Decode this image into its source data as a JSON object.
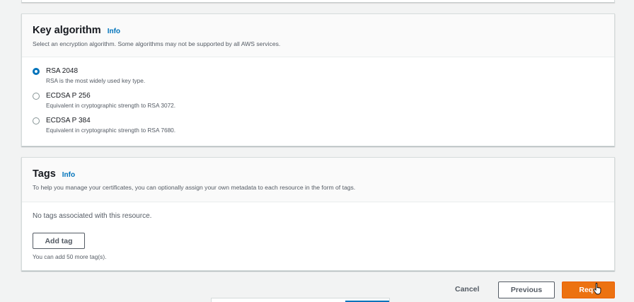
{
  "key_algorithm": {
    "title": "Key algorithm",
    "info": "Info",
    "description": "Select an encryption algorithm. Some algorithms may not be supported by all AWS services.",
    "options": [
      {
        "label": "RSA 2048",
        "description": "RSA is the most widely used key type.",
        "selected": true
      },
      {
        "label": "ECDSA P 256",
        "description": "Equivalent in cryptographic strength to RSA 3072.",
        "selected": false
      },
      {
        "label": "ECDSA P 384",
        "description": "Equivalent in cryptographic strength to RSA 7680.",
        "selected": false
      }
    ]
  },
  "tags": {
    "title": "Tags",
    "info": "Info",
    "description": "To help you manage your certificates, you can optionally assign your own metadata to each resource in the form of tags.",
    "empty_message": "No tags associated with this resource.",
    "add_button": "Add tag",
    "hint": "You can add 50 more tag(s)."
  },
  "footer": {
    "cancel": "Cancel",
    "previous": "Previous",
    "request": "Requ"
  },
  "colors": {
    "primary_button": "#ec7211",
    "link": "#0073bb"
  }
}
